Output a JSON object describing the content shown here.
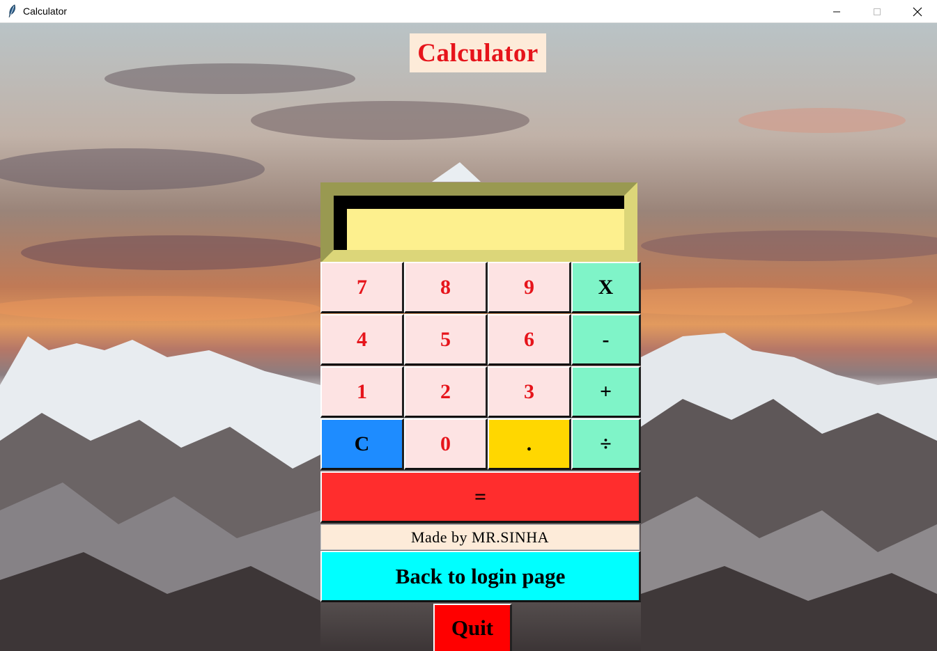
{
  "window": {
    "title": "Calculator",
    "app_icon": "feather-icon",
    "controls": [
      "minimize-icon",
      "maximize-icon",
      "close-icon"
    ]
  },
  "header": {
    "title": "Calculator"
  },
  "display": {
    "value": ""
  },
  "keypad": {
    "rows": [
      [
        "7",
        "8",
        "9",
        "X"
      ],
      [
        "4",
        "5",
        "6",
        "-"
      ],
      [
        "1",
        "2",
        "3",
        "+"
      ],
      [
        "C",
        "0",
        ".",
        "÷"
      ]
    ],
    "equals": "="
  },
  "footer": {
    "credit": "Made by MR.SINHA",
    "back_label": "Back to login page",
    "quit_label": "Quit"
  },
  "colors": {
    "title_text": "#e6141b",
    "title_bg": "#fdebd9",
    "display_bg": "#fdf08e",
    "digit_key": "#fde3e3",
    "operator_key": "#7ff4c8",
    "clear_key": "#1e8cff",
    "dot_key": "#ffd700",
    "equals_key": "#ff2d2d",
    "back_button": "#00ffff",
    "quit_button": "#ff0000"
  }
}
